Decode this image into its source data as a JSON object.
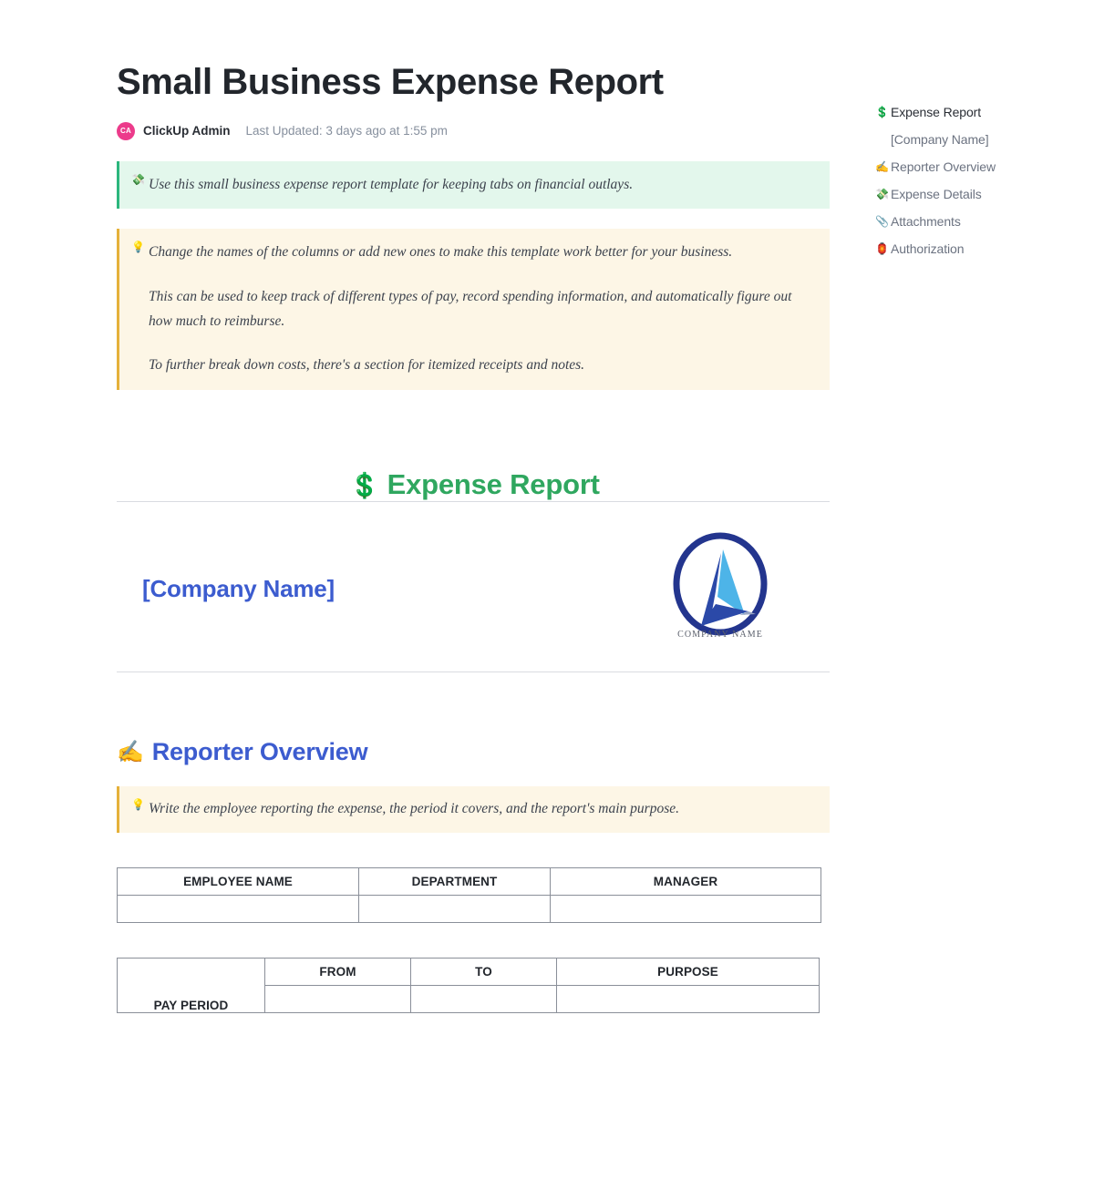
{
  "header": {
    "title": "Small Business Expense Report",
    "avatar_initials": "CA",
    "author": "ClickUp Admin",
    "updated": "Last Updated: 3 days ago at 1:55 pm"
  },
  "callout_green": {
    "icon": "💸",
    "text": "Use this small business expense report template for keeping tabs on financial outlays."
  },
  "callout_yellow": {
    "icon": "💡",
    "paragraphs": [
      "Change the names of the columns or add new ones to make this template work better for your business.",
      "This can be used to keep track of different types of pay, record spending information, and automatically figure out how much to reimburse.",
      "To further break down costs, there's a section for itemized receipts and notes."
    ]
  },
  "expense_report_heading": {
    "icon": "💲",
    "text": "Expense Report",
    "color": "#2fa75f"
  },
  "company": {
    "name": "[Company Name]",
    "name_color": "#3c5ccf",
    "logo_caption": "COMPANY NAME",
    "logo_ring_color": "#23358e",
    "logo_triangle_color": "#4db4e8",
    "logo_swoosh_color": "#2b49a8"
  },
  "reporter_overview": {
    "icon": "✍️",
    "heading": "Reporter Overview",
    "callout_icon": "💡",
    "callout_text": "Write the employee reporting the expense, the period it covers, and the report's main purpose."
  },
  "employee_table": {
    "headers": [
      "EMPLOYEE NAME",
      "DEPARTMENT",
      "MANAGER"
    ],
    "rows": [
      [
        "",
        "",
        ""
      ]
    ]
  },
  "pay_period_table": {
    "row_label": "PAY PERIOD",
    "headers": [
      "FROM",
      "TO",
      "PURPOSE"
    ],
    "rows": [
      [
        "",
        "",
        ""
      ]
    ]
  },
  "toc": {
    "items": [
      {
        "icon": "💲",
        "label": "Expense Report",
        "active": true
      },
      {
        "icon": "",
        "label": "[Company Name]",
        "active": false
      },
      {
        "icon": "✍️",
        "label": "Reporter Overview",
        "active": false
      },
      {
        "icon": "💸",
        "label": "Expense Details",
        "active": false
      },
      {
        "icon": "📎",
        "label": "Attachments",
        "active": false
      },
      {
        "icon": "🏮",
        "label": "Authorization",
        "active": false
      }
    ]
  }
}
